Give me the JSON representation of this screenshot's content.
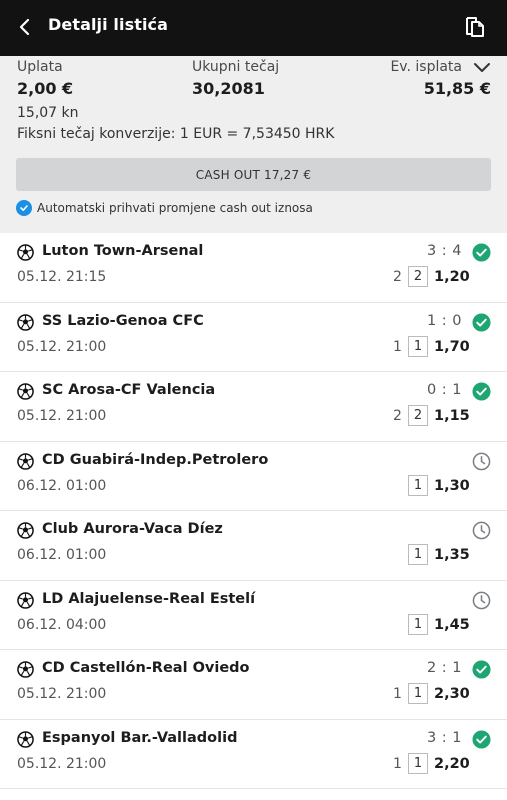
{
  "header": {
    "title": "Detalji listića",
    "back_icon": "chevron-left-icon",
    "action_icon": "copy-icon"
  },
  "summary": {
    "uplata_label": "Uplata",
    "uplata_value": "2,00 €",
    "tecaj_label": "Ukupni tečaj",
    "tecaj_value": "30,2081",
    "isplata_label": "Ev. isplata",
    "isplata_value": "51,85 €",
    "kn_value": "15,07 kn",
    "conversion": "Fiksni tečaj konverzije: 1 EUR = 7,53450 HRK",
    "cashout_label": "CASH OUT 17,27 €",
    "auto_accept": "Automatski prihvati promjene cash out iznosa",
    "auto_accept_checked": true
  },
  "colors": {
    "header_bg": "#121212",
    "won": "#1ea672",
    "pending": "#7a7f85",
    "check_blue": "#1a8fe3"
  },
  "bets": [
    {
      "match": "Luton Town-Arsenal",
      "datetime": "05.12. 21:15",
      "score": "3 : 4",
      "tip_a": "2",
      "tip_b": "2",
      "odd": "1,20",
      "status": "won"
    },
    {
      "match": "SS Lazio-Genoa CFC",
      "datetime": "05.12. 21:00",
      "score": "1 : 0",
      "tip_a": "1",
      "tip_b": "1",
      "odd": "1,70",
      "status": "won"
    },
    {
      "match": "SC Arosa-CF Valencia",
      "datetime": "05.12. 21:00",
      "score": "0 : 1",
      "tip_a": "2",
      "tip_b": "2",
      "odd": "1,15",
      "status": "won"
    },
    {
      "match": "CD Guabirá-Indep.Petrolero",
      "datetime": "06.12. 01:00",
      "score": "",
      "tip_a": "",
      "tip_b": "1",
      "odd": "1,30",
      "status": "pending"
    },
    {
      "match": "Club Aurora-Vaca Díez",
      "datetime": "06.12. 01:00",
      "score": "",
      "tip_a": "",
      "tip_b": "1",
      "odd": "1,35",
      "status": "pending"
    },
    {
      "match": "LD Alajuelense-Real Estelí",
      "datetime": "06.12. 04:00",
      "score": "",
      "tip_a": "",
      "tip_b": "1",
      "odd": "1,45",
      "status": "pending"
    },
    {
      "match": "CD Castellón-Real Oviedo",
      "datetime": "05.12. 21:00",
      "score": "2 : 1",
      "tip_a": "1",
      "tip_b": "1",
      "odd": "2,30",
      "status": "won"
    },
    {
      "match": "Espanyol Bar.-Valladolid",
      "datetime": "05.12. 21:00",
      "score": "3 : 1",
      "tip_a": "1",
      "tip_b": "1",
      "odd": "2,20",
      "status": "won"
    }
  ]
}
